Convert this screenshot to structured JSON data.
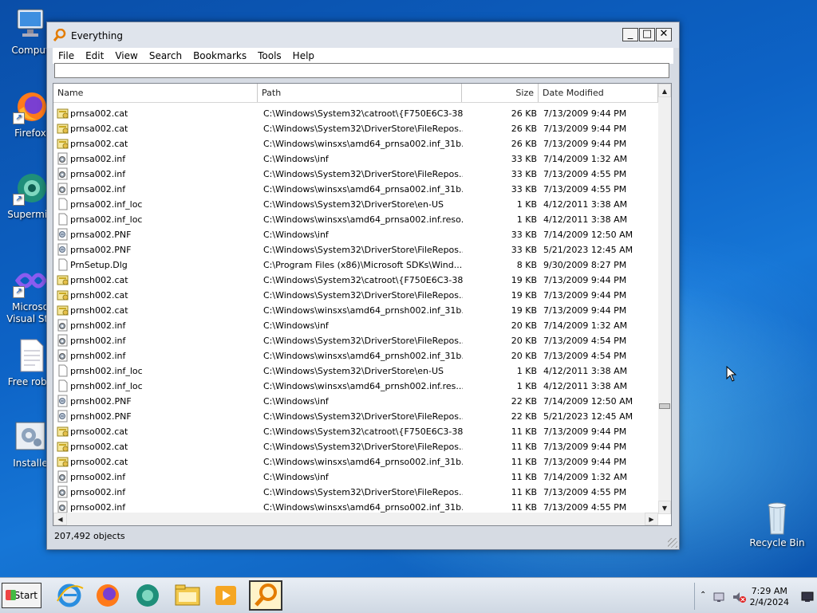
{
  "desktop": {
    "icons": [
      {
        "label": "Comput",
        "icon": "computer-icon"
      },
      {
        "label": "Firefox",
        "icon": "firefox-icon"
      },
      {
        "label": "Supermiu",
        "icon": "supermium-icon"
      },
      {
        "label": "Microso",
        "label2": "Visual Stu",
        "icon": "visual-studio-icon"
      },
      {
        "label": "Free robu",
        "icon": "document-icon"
      },
      {
        "label": "Installe",
        "icon": "installer-icon"
      },
      {
        "label": "Recycle Bin",
        "icon": "recycle-bin-icon"
      }
    ]
  },
  "window": {
    "title": "Everything",
    "minimize": "_",
    "maximize": "□",
    "close": "✕",
    "menu": [
      "File",
      "Edit",
      "View",
      "Search",
      "Bookmarks",
      "Tools",
      "Help"
    ],
    "search_value": "",
    "columns": {
      "name": "Name",
      "path": "Path",
      "size": "Size",
      "date": "Date Modified"
    },
    "rows": [
      {
        "name": "prnsa002.cat",
        "path": "C:\\Windows\\System32\\catroot\\{F750E6C3-38...",
        "size": "26 KB",
        "date": "7/13/2009 9:44 PM",
        "type": "cat"
      },
      {
        "name": "prnsa002.cat",
        "path": "C:\\Windows\\System32\\DriverStore\\FileRepos...",
        "size": "26 KB",
        "date": "7/13/2009 9:44 PM",
        "type": "cat"
      },
      {
        "name": "prnsa002.cat",
        "path": "C:\\Windows\\winsxs\\amd64_prnsa002.inf_31b...",
        "size": "26 KB",
        "date": "7/13/2009 9:44 PM",
        "type": "cat"
      },
      {
        "name": "prnsa002.inf",
        "path": "C:\\Windows\\inf",
        "size": "33 KB",
        "date": "7/14/2009 1:32 AM",
        "type": "inf"
      },
      {
        "name": "prnsa002.inf",
        "path": "C:\\Windows\\System32\\DriverStore\\FileRepos...",
        "size": "33 KB",
        "date": "7/13/2009 4:55 PM",
        "type": "inf"
      },
      {
        "name": "prnsa002.inf",
        "path": "C:\\Windows\\winsxs\\amd64_prnsa002.inf_31b...",
        "size": "33 KB",
        "date": "7/13/2009 4:55 PM",
        "type": "inf"
      },
      {
        "name": "prnsa002.inf_loc",
        "path": "C:\\Windows\\System32\\DriverStore\\en-US",
        "size": "1 KB",
        "date": "4/12/2011 3:38 AM",
        "type": "blank"
      },
      {
        "name": "prnsa002.inf_loc",
        "path": "C:\\Windows\\winsxs\\amd64_prnsa002.inf.reso...",
        "size": "1 KB",
        "date": "4/12/2011 3:38 AM",
        "type": "blank"
      },
      {
        "name": "prnsa002.PNF",
        "path": "C:\\Windows\\inf",
        "size": "33 KB",
        "date": "7/14/2009 12:50 AM",
        "type": "pnf"
      },
      {
        "name": "prnsa002.PNF",
        "path": "C:\\Windows\\System32\\DriverStore\\FileRepos...",
        "size": "33 KB",
        "date": "5/21/2023 12:45 AM",
        "type": "pnf"
      },
      {
        "name": "PrnSetup.Dlg",
        "path": "C:\\Program Files (x86)\\Microsoft SDKs\\Wind...",
        "size": "8 KB",
        "date": "9/30/2009 8:27 PM",
        "type": "blank"
      },
      {
        "name": "prnsh002.cat",
        "path": "C:\\Windows\\System32\\catroot\\{F750E6C3-38...",
        "size": "19 KB",
        "date": "7/13/2009 9:44 PM",
        "type": "cat"
      },
      {
        "name": "prnsh002.cat",
        "path": "C:\\Windows\\System32\\DriverStore\\FileRepos...",
        "size": "19 KB",
        "date": "7/13/2009 9:44 PM",
        "type": "cat"
      },
      {
        "name": "prnsh002.cat",
        "path": "C:\\Windows\\winsxs\\amd64_prnsh002.inf_31b...",
        "size": "19 KB",
        "date": "7/13/2009 9:44 PM",
        "type": "cat"
      },
      {
        "name": "prnsh002.inf",
        "path": "C:\\Windows\\inf",
        "size": "20 KB",
        "date": "7/14/2009 1:32 AM",
        "type": "inf"
      },
      {
        "name": "prnsh002.inf",
        "path": "C:\\Windows\\System32\\DriverStore\\FileRepos...",
        "size": "20 KB",
        "date": "7/13/2009 4:54 PM",
        "type": "inf"
      },
      {
        "name": "prnsh002.inf",
        "path": "C:\\Windows\\winsxs\\amd64_prnsh002.inf_31b...",
        "size": "20 KB",
        "date": "7/13/2009 4:54 PM",
        "type": "inf"
      },
      {
        "name": "prnsh002.inf_loc",
        "path": "C:\\Windows\\System32\\DriverStore\\en-US",
        "size": "1 KB",
        "date": "4/12/2011 3:38 AM",
        "type": "blank"
      },
      {
        "name": "prnsh002.inf_loc",
        "path": "C:\\Windows\\winsxs\\amd64_prnsh002.inf.res...",
        "size": "1 KB",
        "date": "4/12/2011 3:38 AM",
        "type": "blank"
      },
      {
        "name": "prnsh002.PNF",
        "path": "C:\\Windows\\inf",
        "size": "22 KB",
        "date": "7/14/2009 12:50 AM",
        "type": "pnf"
      },
      {
        "name": "prnsh002.PNF",
        "path": "C:\\Windows\\System32\\DriverStore\\FileRepos...",
        "size": "22 KB",
        "date": "5/21/2023 12:45 AM",
        "type": "pnf"
      },
      {
        "name": "prnso002.cat",
        "path": "C:\\Windows\\System32\\catroot\\{F750E6C3-38...",
        "size": "11 KB",
        "date": "7/13/2009 9:44 PM",
        "type": "cat"
      },
      {
        "name": "prnso002.cat",
        "path": "C:\\Windows\\System32\\DriverStore\\FileRepos...",
        "size": "11 KB",
        "date": "7/13/2009 9:44 PM",
        "type": "cat"
      },
      {
        "name": "prnso002.cat",
        "path": "C:\\Windows\\winsxs\\amd64_prnso002.inf_31b...",
        "size": "11 KB",
        "date": "7/13/2009 9:44 PM",
        "type": "cat"
      },
      {
        "name": "prnso002.inf",
        "path": "C:\\Windows\\inf",
        "size": "11 KB",
        "date": "7/14/2009 1:32 AM",
        "type": "inf"
      },
      {
        "name": "prnso002.inf",
        "path": "C:\\Windows\\System32\\DriverStore\\FileRepos...",
        "size": "11 KB",
        "date": "7/13/2009 4:55 PM",
        "type": "inf"
      },
      {
        "name": "prnso002.inf",
        "path": "C:\\Windows\\winsxs\\amd64_prnso002.inf_31b...",
        "size": "11 KB",
        "date": "7/13/2009 4:55 PM",
        "type": "inf"
      }
    ],
    "status": "207,492 objects"
  },
  "taskbar": {
    "start_label": "Start",
    "apps": [
      "internet-explorer-icon",
      "firefox-icon",
      "supermium-icon",
      "file-explorer-icon",
      "media-player-icon",
      "everything-icon"
    ],
    "clock_time": "7:29 AM",
    "clock_date": "2/4/2024"
  },
  "colors": {
    "desktop_blue": "#0d63c6",
    "active_task": "#fff3c9"
  }
}
